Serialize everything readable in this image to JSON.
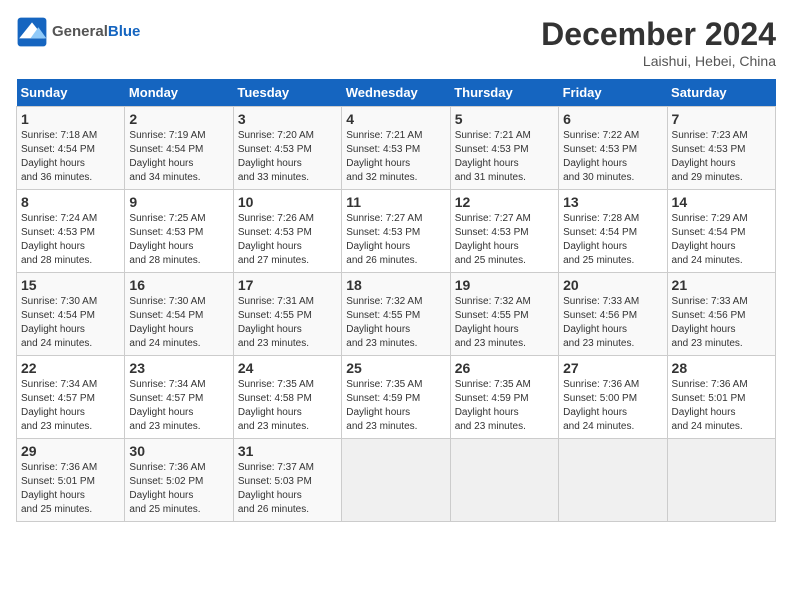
{
  "header": {
    "logo_text_general": "General",
    "logo_text_blue": "Blue",
    "month_title": "December 2024",
    "location": "Laishui, Hebei, China"
  },
  "weekdays": [
    "Sunday",
    "Monday",
    "Tuesday",
    "Wednesday",
    "Thursday",
    "Friday",
    "Saturday"
  ],
  "weeks": [
    [
      {
        "day": 1,
        "sunrise": "7:18 AM",
        "sunset": "4:54 PM",
        "daylight": "9 hours and 36 minutes."
      },
      {
        "day": 2,
        "sunrise": "7:19 AM",
        "sunset": "4:54 PM",
        "daylight": "9 hours and 34 minutes."
      },
      {
        "day": 3,
        "sunrise": "7:20 AM",
        "sunset": "4:53 PM",
        "daylight": "9 hours and 33 minutes."
      },
      {
        "day": 4,
        "sunrise": "7:21 AM",
        "sunset": "4:53 PM",
        "daylight": "9 hours and 32 minutes."
      },
      {
        "day": 5,
        "sunrise": "7:21 AM",
        "sunset": "4:53 PM",
        "daylight": "9 hours and 31 minutes."
      },
      {
        "day": 6,
        "sunrise": "7:22 AM",
        "sunset": "4:53 PM",
        "daylight": "9 hours and 30 minutes."
      },
      {
        "day": 7,
        "sunrise": "7:23 AM",
        "sunset": "4:53 PM",
        "daylight": "9 hours and 29 minutes."
      }
    ],
    [
      {
        "day": 8,
        "sunrise": "7:24 AM",
        "sunset": "4:53 PM",
        "daylight": "9 hours and 28 minutes."
      },
      {
        "day": 9,
        "sunrise": "7:25 AM",
        "sunset": "4:53 PM",
        "daylight": "9 hours and 28 minutes."
      },
      {
        "day": 10,
        "sunrise": "7:26 AM",
        "sunset": "4:53 PM",
        "daylight": "9 hours and 27 minutes."
      },
      {
        "day": 11,
        "sunrise": "7:27 AM",
        "sunset": "4:53 PM",
        "daylight": "9 hours and 26 minutes."
      },
      {
        "day": 12,
        "sunrise": "7:27 AM",
        "sunset": "4:53 PM",
        "daylight": "9 hours and 25 minutes."
      },
      {
        "day": 13,
        "sunrise": "7:28 AM",
        "sunset": "4:54 PM",
        "daylight": "9 hours and 25 minutes."
      },
      {
        "day": 14,
        "sunrise": "7:29 AM",
        "sunset": "4:54 PM",
        "daylight": "9 hours and 24 minutes."
      }
    ],
    [
      {
        "day": 15,
        "sunrise": "7:30 AM",
        "sunset": "4:54 PM",
        "daylight": "9 hours and 24 minutes."
      },
      {
        "day": 16,
        "sunrise": "7:30 AM",
        "sunset": "4:54 PM",
        "daylight": "9 hours and 24 minutes."
      },
      {
        "day": 17,
        "sunrise": "7:31 AM",
        "sunset": "4:55 PM",
        "daylight": "9 hours and 23 minutes."
      },
      {
        "day": 18,
        "sunrise": "7:32 AM",
        "sunset": "4:55 PM",
        "daylight": "9 hours and 23 minutes."
      },
      {
        "day": 19,
        "sunrise": "7:32 AM",
        "sunset": "4:55 PM",
        "daylight": "9 hours and 23 minutes."
      },
      {
        "day": 20,
        "sunrise": "7:33 AM",
        "sunset": "4:56 PM",
        "daylight": "9 hours and 23 minutes."
      },
      {
        "day": 21,
        "sunrise": "7:33 AM",
        "sunset": "4:56 PM",
        "daylight": "9 hours and 23 minutes."
      }
    ],
    [
      {
        "day": 22,
        "sunrise": "7:34 AM",
        "sunset": "4:57 PM",
        "daylight": "9 hours and 23 minutes."
      },
      {
        "day": 23,
        "sunrise": "7:34 AM",
        "sunset": "4:57 PM",
        "daylight": "9 hours and 23 minutes."
      },
      {
        "day": 24,
        "sunrise": "7:35 AM",
        "sunset": "4:58 PM",
        "daylight": "9 hours and 23 minutes."
      },
      {
        "day": 25,
        "sunrise": "7:35 AM",
        "sunset": "4:59 PM",
        "daylight": "9 hours and 23 minutes."
      },
      {
        "day": 26,
        "sunrise": "7:35 AM",
        "sunset": "4:59 PM",
        "daylight": "9 hours and 23 minutes."
      },
      {
        "day": 27,
        "sunrise": "7:36 AM",
        "sunset": "5:00 PM",
        "daylight": "9 hours and 24 minutes."
      },
      {
        "day": 28,
        "sunrise": "7:36 AM",
        "sunset": "5:01 PM",
        "daylight": "9 hours and 24 minutes."
      }
    ],
    [
      {
        "day": 29,
        "sunrise": "7:36 AM",
        "sunset": "5:01 PM",
        "daylight": "9 hours and 25 minutes."
      },
      {
        "day": 30,
        "sunrise": "7:36 AM",
        "sunset": "5:02 PM",
        "daylight": "9 hours and 25 minutes."
      },
      {
        "day": 31,
        "sunrise": "7:37 AM",
        "sunset": "5:03 PM",
        "daylight": "9 hours and 26 minutes."
      },
      null,
      null,
      null,
      null
    ]
  ],
  "labels": {
    "sunrise": "Sunrise:",
    "sunset": "Sunset:",
    "daylight": "Daylight hours"
  }
}
